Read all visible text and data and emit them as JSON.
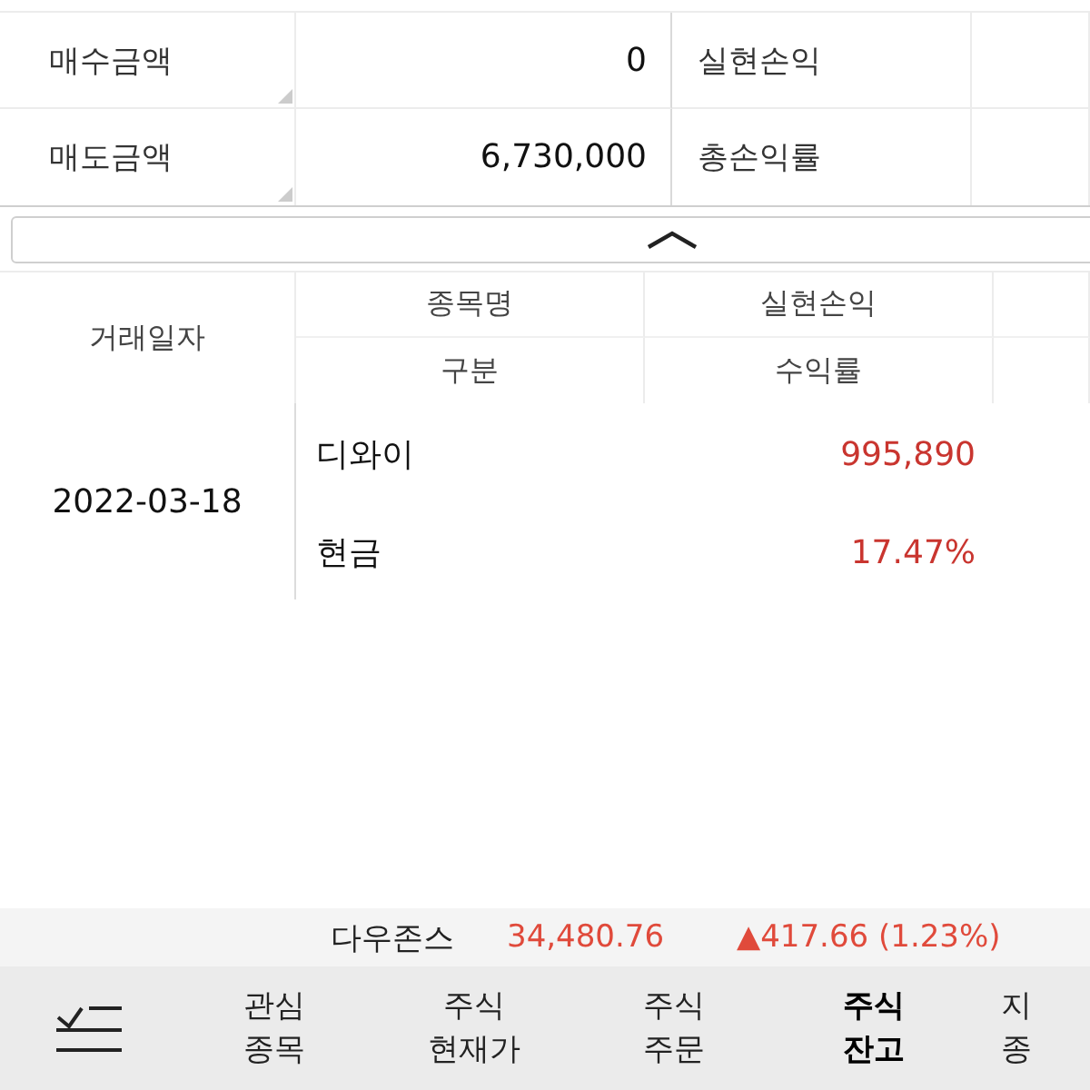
{
  "summary": {
    "rows": [
      {
        "label": "매수금액",
        "value": "0",
        "label_2": "실현손익"
      },
      {
        "label": "매도금액",
        "value": "6,730,000",
        "label_2": "총손익률"
      }
    ]
  },
  "table": {
    "columns": [
      {
        "lines": [
          "거래일자"
        ]
      },
      {
        "lines": [
          "종목명",
          "구분"
        ]
      },
      {
        "lines": [
          "실현손익",
          "수익률"
        ]
      }
    ],
    "rows": [
      {
        "date": "2022-03-18",
        "name": "디와이",
        "type": "현금",
        "profit": "995,890",
        "rate": "17.47%"
      }
    ]
  },
  "ticker": {
    "name": "다우존스",
    "price": "34,480.76",
    "change": "▲417.66 (1.23%)"
  },
  "bottom_nav": {
    "items": [
      {
        "lines": [
          "관심",
          "종목"
        ],
        "selected": false
      },
      {
        "lines": [
          "주식",
          "현재가"
        ],
        "selected": false
      },
      {
        "lines": [
          "주식",
          "주문"
        ],
        "selected": false
      },
      {
        "lines": [
          "주식",
          "잔고"
        ],
        "selected": true
      },
      {
        "lines": [
          "지",
          "종"
        ],
        "selected": false
      }
    ]
  }
}
